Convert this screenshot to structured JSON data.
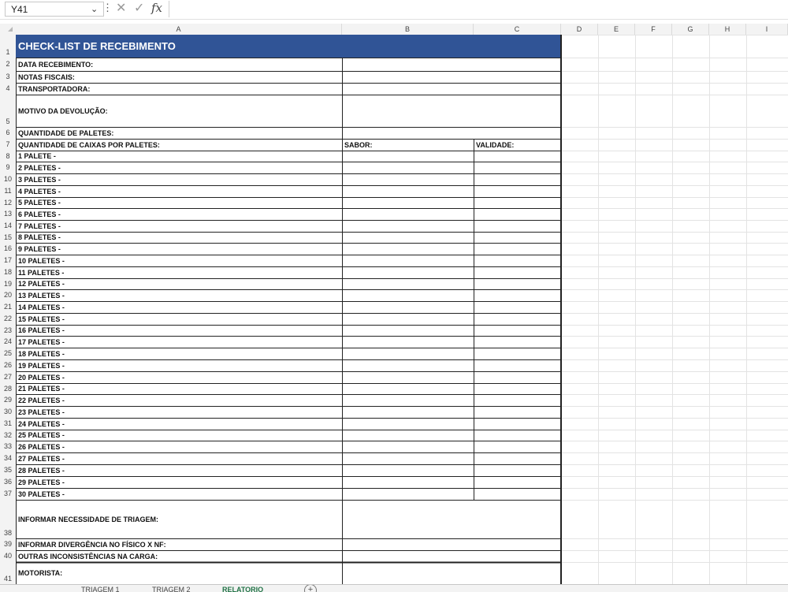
{
  "formula_bar": {
    "name_box": "Y41",
    "name_box_arrow": "⌄",
    "dots": "⋮",
    "cancel_symbol": "✕",
    "enter_symbol": "✓",
    "fx_label": "fx",
    "formula_value": ""
  },
  "columns": [
    "A",
    "B",
    "C",
    "D",
    "E",
    "F",
    "G",
    "H",
    "I"
  ],
  "title": "CHECK-LIST DE RECEBIMENTO",
  "rows": [
    {
      "num": "1",
      "a": "",
      "b": "",
      "c": ""
    },
    {
      "num": "2",
      "a": "DATA RECEBIMENTO:",
      "b": "",
      "c": ""
    },
    {
      "num": "3",
      "a": "NOTAS FISCAIS:",
      "b": "",
      "c": ""
    },
    {
      "num": "4",
      "a": "TRANSPORTADORA:",
      "b": "",
      "c": ""
    },
    {
      "num": "5",
      "a": "MOTIVO DA DEVOLUÇÃO:",
      "b": "",
      "c": ""
    },
    {
      "num": "6",
      "a": "QUANTIDADE DE PALETES:",
      "b": "",
      "c": ""
    },
    {
      "num": "7",
      "a": "QUANTIDADE DE CAIXAS POR PALETES:",
      "b": "SABOR:",
      "c": "VALIDADE:"
    },
    {
      "num": "8",
      "a": "1 PALETE -",
      "b": "",
      "c": ""
    },
    {
      "num": "9",
      "a": "2 PALETES -",
      "b": "",
      "c": ""
    },
    {
      "num": "10",
      "a": "3 PALETES -",
      "b": "",
      "c": ""
    },
    {
      "num": "11",
      "a": "4 PALETES -",
      "b": "",
      "c": ""
    },
    {
      "num": "12",
      "a": "5 PALETES -",
      "b": "",
      "c": ""
    },
    {
      "num": "13",
      "a": "6 PALETES -",
      "b": "",
      "c": ""
    },
    {
      "num": "14",
      "a": "7 PALETES -",
      "b": "",
      "c": ""
    },
    {
      "num": "15",
      "a": "8 PALETES -",
      "b": "",
      "c": ""
    },
    {
      "num": "16",
      "a": "9 PALETES -",
      "b": "",
      "c": ""
    },
    {
      "num": "17",
      "a": "10 PALETES -",
      "b": "",
      "c": ""
    },
    {
      "num": "18",
      "a": "11 PALETES -",
      "b": "",
      "c": ""
    },
    {
      "num": "19",
      "a": "12 PALETES -",
      "b": "",
      "c": ""
    },
    {
      "num": "20",
      "a": "13 PALETES -",
      "b": "",
      "c": ""
    },
    {
      "num": "21",
      "a": "14 PALETES -",
      "b": "",
      "c": ""
    },
    {
      "num": "22",
      "a": "15 PALETES -",
      "b": "",
      "c": ""
    },
    {
      "num": "23",
      "a": "16 PALETES -",
      "b": "",
      "c": ""
    },
    {
      "num": "24",
      "a": "17 PALETES -",
      "b": "",
      "c": ""
    },
    {
      "num": "25",
      "a": "18 PALETES -",
      "b": "",
      "c": ""
    },
    {
      "num": "26",
      "a": "19 PALETES -",
      "b": "",
      "c": ""
    },
    {
      "num": "27",
      "a": "20 PALETES -",
      "b": "",
      "c": ""
    },
    {
      "num": "28",
      "a": "21 PALETES -",
      "b": "",
      "c": ""
    },
    {
      "num": "29",
      "a": "22 PALETES -",
      "b": "",
      "c": ""
    },
    {
      "num": "30",
      "a": "23 PALETES -",
      "b": "",
      "c": ""
    },
    {
      "num": "31",
      "a": "24 PALETES -",
      "b": "",
      "c": ""
    },
    {
      "num": "32",
      "a": "25 PALETES -",
      "b": "",
      "c": ""
    },
    {
      "num": "33",
      "a": "26 PALETES -",
      "b": "",
      "c": ""
    },
    {
      "num": "34",
      "a": "27 PALETES -",
      "b": "",
      "c": ""
    },
    {
      "num": "35",
      "a": "28 PALETES -",
      "b": "",
      "c": ""
    },
    {
      "num": "36",
      "a": "29 PALETES -",
      "b": "",
      "c": ""
    },
    {
      "num": "37",
      "a": "30 PALETES -",
      "b": "",
      "c": ""
    },
    {
      "num": "38",
      "a": "INFORMAR NECESSIDADE DE TRIAGEM:",
      "b": "",
      "c": ""
    },
    {
      "num": "39",
      "a": "INFORMAR DIVERGÊNCIA NO FÍSICO X NF:",
      "b": "",
      "c": ""
    },
    {
      "num": "40",
      "a": "OUTRAS INCONSISTÊNCIAS NA CARGA:",
      "b": "",
      "c": ""
    },
    {
      "num": "41",
      "a": "MOTORISTA:",
      "b": "",
      "c": ""
    }
  ],
  "sheet_tabs": [
    "TRIAGEM 1",
    "TRIAGEM 2",
    "RELATORIO"
  ],
  "active_tab": "RELATORIO",
  "add_sheet_symbol": "+",
  "colors": {
    "title_fill": "#305496",
    "title_text": "#ffffff",
    "active_tab": "#217346"
  }
}
